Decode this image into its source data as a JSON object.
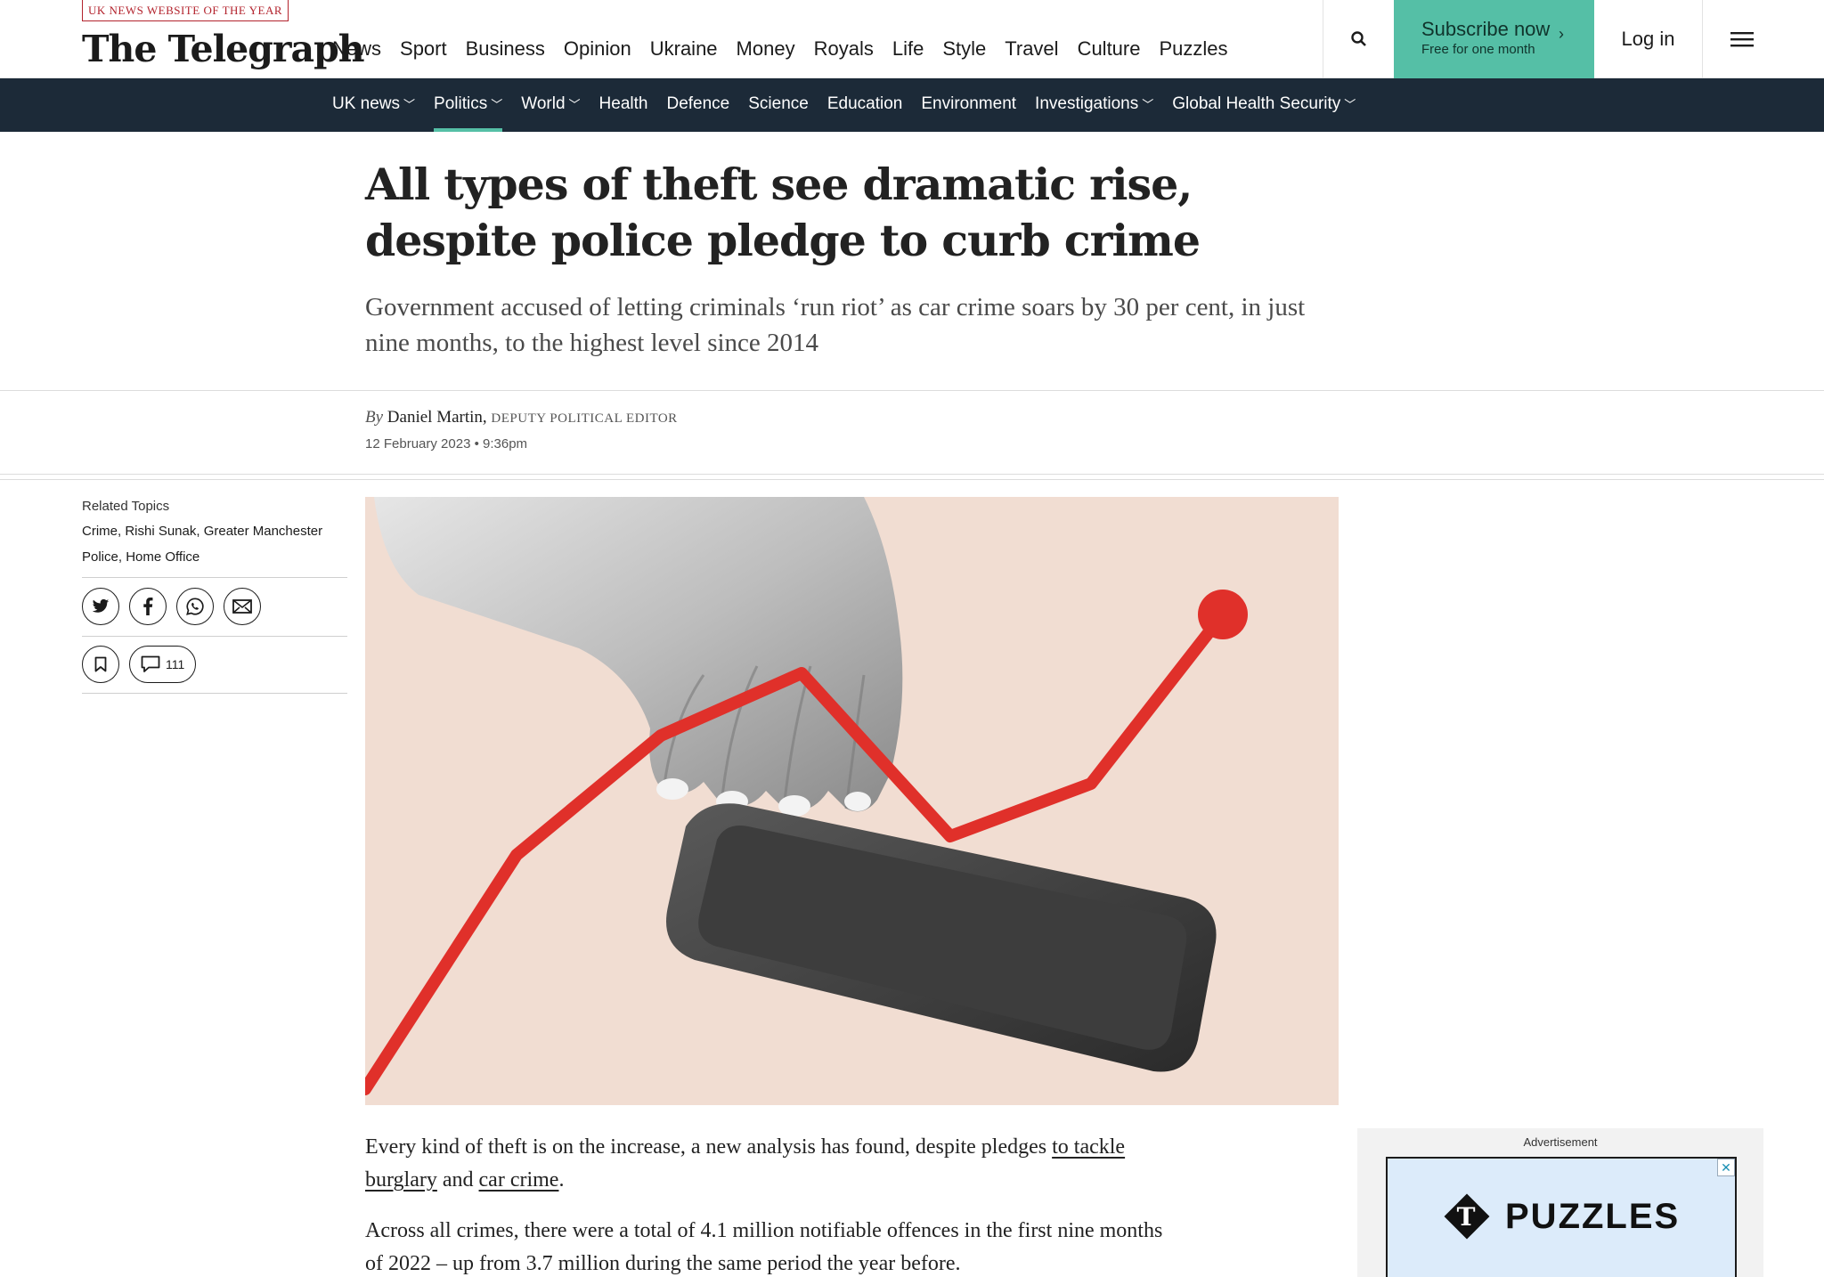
{
  "header": {
    "award": "UK NEWS WEBSITE OF THE YEAR",
    "logo": "The Telegraph",
    "nav": [
      "News",
      "Sport",
      "Business",
      "Opinion",
      "Ukraine",
      "Money",
      "Royals",
      "Life",
      "Style",
      "Travel",
      "Culture",
      "Puzzles"
    ],
    "subscribe_label": "Subscribe now",
    "subscribe_sub": "Free for one month",
    "login_label": "Log in"
  },
  "subnav": {
    "items": [
      {
        "label": "UK news",
        "dropdown": true
      },
      {
        "label": "Politics",
        "dropdown": true,
        "active": true
      },
      {
        "label": "World",
        "dropdown": true
      },
      {
        "label": "Health",
        "dropdown": false
      },
      {
        "label": "Defence",
        "dropdown": false
      },
      {
        "label": "Science",
        "dropdown": false
      },
      {
        "label": "Education",
        "dropdown": false
      },
      {
        "label": "Environment",
        "dropdown": false
      },
      {
        "label": "Investigations",
        "dropdown": true
      },
      {
        "label": "Global Health Security",
        "dropdown": true
      }
    ]
  },
  "article": {
    "headline": "All types of theft see dramatic rise, despite police pledge to curb crime",
    "standfirst": "Government accused of letting criminals ‘run riot’ as car crime soars by 30 per cent, in just nine months, to the highest level since 2014",
    "by": "By",
    "author": "Daniel Martin,",
    "author_role": "DEPUTY POLITICAL EDITOR",
    "date": "12 February 2023 • 9:36pm",
    "p1_a": "Every kind of theft is on the increase, a new analysis has found, despite pledges ",
    "p1_link1": "to tackle burglary",
    "p1_b": " and ",
    "p1_link2": "car crime",
    "p1_c": ".",
    "p2": "Across all crimes, there were a total of 4.1 million notifiable offences in the first nine months of 2022 – up from 3.7 million during the same period the year before."
  },
  "sidebar": {
    "related_label": "Related Topics",
    "related_topics": "Crime, Rishi Sunak, Greater Manchester Police, Home Office",
    "comment_count": "111"
  },
  "ad": {
    "label": "Advertisement",
    "brand": "PUZZLES",
    "close": "✕"
  },
  "colors": {
    "accent": "#55bfa6",
    "subnav_bg": "#1c2a38",
    "award": "#b3232d",
    "hero_line": "#e0302a"
  }
}
